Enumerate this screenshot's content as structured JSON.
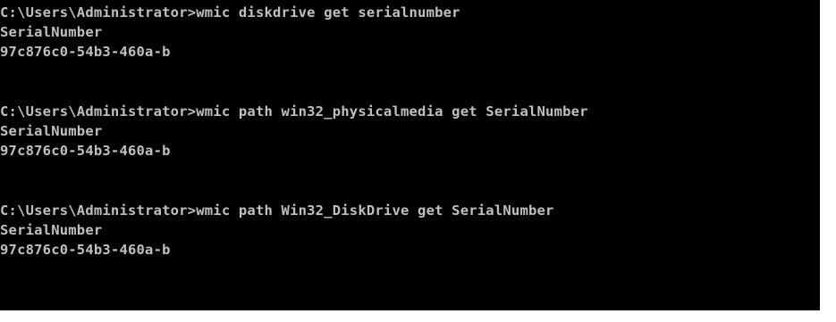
{
  "console": {
    "lines": [
      "C:\\Users\\Administrator>wmic diskdrive get serialnumber",
      "SerialNumber",
      "97c876c0-54b3-460a-b",
      "",
      "",
      "C:\\Users\\Administrator>wmic path win32_physicalmedia get SerialNumber",
      "SerialNumber",
      "97c876c0-54b3-460a-b",
      "",
      "",
      "C:\\Users\\Administrator>wmic path Win32_DiskDrive get SerialNumber",
      "SerialNumber",
      "97c876c0-54b3-460a-b"
    ]
  },
  "colors": {
    "background": "#000000",
    "text": "#c0c0c0"
  }
}
